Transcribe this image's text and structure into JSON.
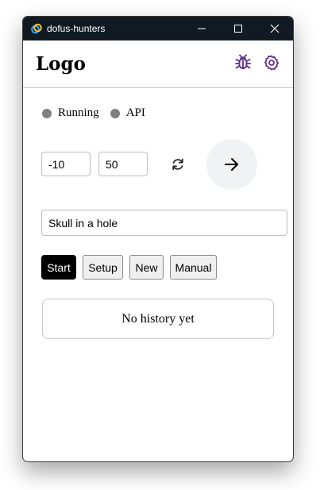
{
  "window": {
    "title": "dofus-hunters",
    "controls": [
      "minimize-icon",
      "maximize-icon",
      "close-icon"
    ]
  },
  "header": {
    "logo": "Logo",
    "icons": [
      "bug-icon",
      "gear-icon"
    ],
    "accent_color": "#5b2a86"
  },
  "status": {
    "running_label": "Running",
    "api_label": "API",
    "indicator_color": "#7f7f7f"
  },
  "coords": {
    "x": "-10",
    "y": "50"
  },
  "hint": {
    "value": "Skull in a hole"
  },
  "actions": {
    "start": "Start",
    "setup": "Setup",
    "new": "New",
    "manual": "Manual"
  },
  "history": {
    "empty_text": "No history yet"
  }
}
